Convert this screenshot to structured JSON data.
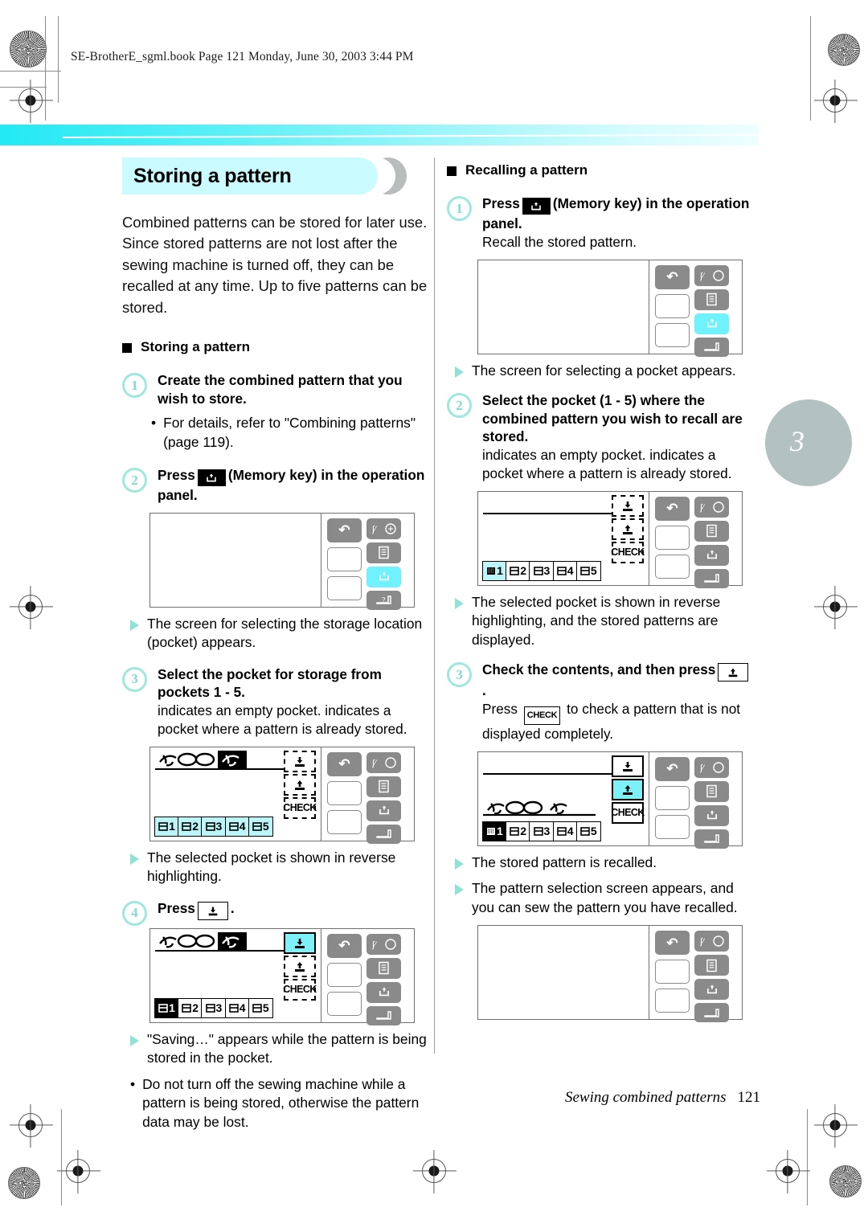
{
  "header": {
    "book_line": "SE-BrotherE_sgml.book  Page 121  Monday, June 30, 2003  3:44 PM"
  },
  "chapter_tab": {
    "number": "3"
  },
  "colors": {
    "banner_fill": "#c9fbff",
    "banner_moon": "#b9bcbc",
    "top_band": "#22e9f3",
    "step_circle": "#9fe8dd",
    "triangle_bullet": "#8fe3d4",
    "lcd_key": "#8a8a8a",
    "lcd_highlight": "#6ff2fb",
    "pocket_cyan": "#bdf6fa",
    "chapter_tab": "#b3c1c1"
  },
  "left": {
    "title": "Storing a pattern",
    "intro": "Combined patterns can be stored for later use. Since stored patterns are not lost after the sewing machine is turned off, they can be recalled at any time. Up to five patterns can be stored.",
    "subhead": "Storing a pattern",
    "step1": {
      "num": "1",
      "text": "Create the combined pattern that you wish to store."
    },
    "step1_note": {
      "bullet": "•",
      "text": "For details, refer to \"Combining patterns\" (page 119)."
    },
    "step2": {
      "num": "2",
      "text_before": "Press",
      "key_label": "memory-key",
      "text_after": "(Memory key) in the operation panel."
    },
    "step2_result": "The screen for selecting the storage location (pocket) appears.",
    "step3": {
      "num": "3",
      "text": "Select the pocket for storage from pockets 1 - 5.",
      "note": "indicates an empty pocket.        indicates a pocket where a pattern is already stored."
    },
    "step3_result": "The selected pocket is shown in reverse highlighting.",
    "step4": {
      "num": "4",
      "text_before": "Press",
      "key_label": "store-key",
      "text_after": "."
    },
    "step4_result": "\"Saving…\" appears while the pattern is being stored in the pocket.",
    "step4_note": {
      "bullet": "•",
      "text": "Do not turn off the sewing machine while a pattern is being stored, otherwise the pattern data may be lost."
    },
    "pockets": [
      "1",
      "2",
      "3",
      "4",
      "5"
    ],
    "check_label": "CHECK"
  },
  "right": {
    "subhead": "Recalling a pattern",
    "step1": {
      "num": "1",
      "text_before": "Press",
      "key_label": "memory-key",
      "text_after": "(Memory key) in the operation panel.",
      "sub": "Recall the stored pattern."
    },
    "step1_result": "The screen for selecting a pocket appears.",
    "step2": {
      "num": "2",
      "text": "Select the pocket (1 - 5) where the combined pattern you wish to recall are stored.",
      "note": "indicates an empty pocket.        indicates a pocket where a pattern is already stored."
    },
    "step2_result": "The selected pocket is shown in reverse highlighting, and the stored patterns are displayed.",
    "step3": {
      "num": "3",
      "text_before": "Check the contents, and then press",
      "key_label": "recall-key",
      "text_after": ".",
      "sub_before": "Press",
      "sub_chip": "CHECK",
      "sub_after": "to check a pattern that is not displayed completely."
    },
    "step3_result_a": "The stored pattern is recalled.",
    "step3_result_b": "The pattern selection screen appears, and you can sew the pattern you have recalled.",
    "pockets": [
      "1",
      "2",
      "3",
      "4",
      "5"
    ],
    "check_label": "CHECK"
  },
  "footer": {
    "title": "Sewing combined patterns",
    "page": "121"
  }
}
